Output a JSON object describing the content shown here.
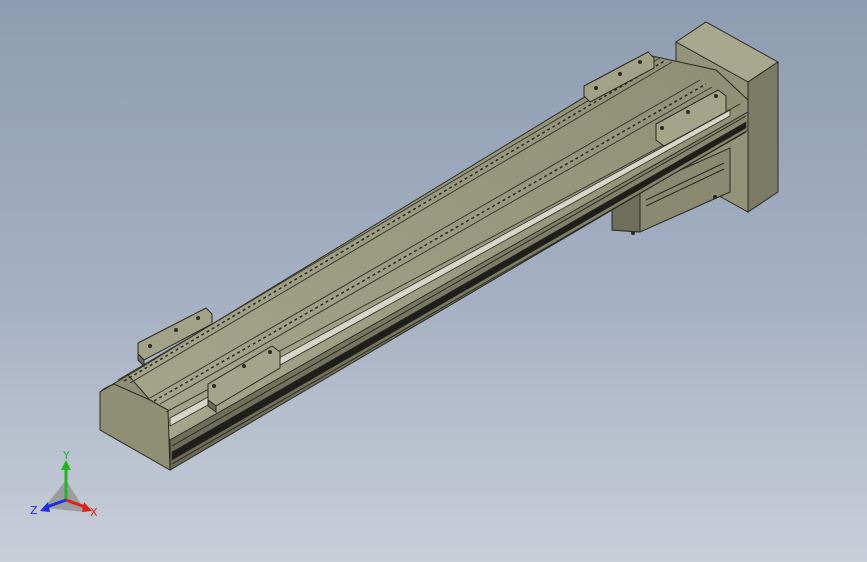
{
  "scene": {
    "background_top": "#8e9db1",
    "background_bottom": "#c9cfd9",
    "part_color": "#9a9a80",
    "part_shadow": "#6c6c58",
    "part_highlight": "#b8b89f",
    "edge_color": "#2a2a22"
  },
  "triad": {
    "x_label": "X",
    "y_label": "Y",
    "z_label": "Z",
    "x_color": "#e0201a",
    "y_color": "#24b424",
    "z_color": "#2030e0"
  }
}
